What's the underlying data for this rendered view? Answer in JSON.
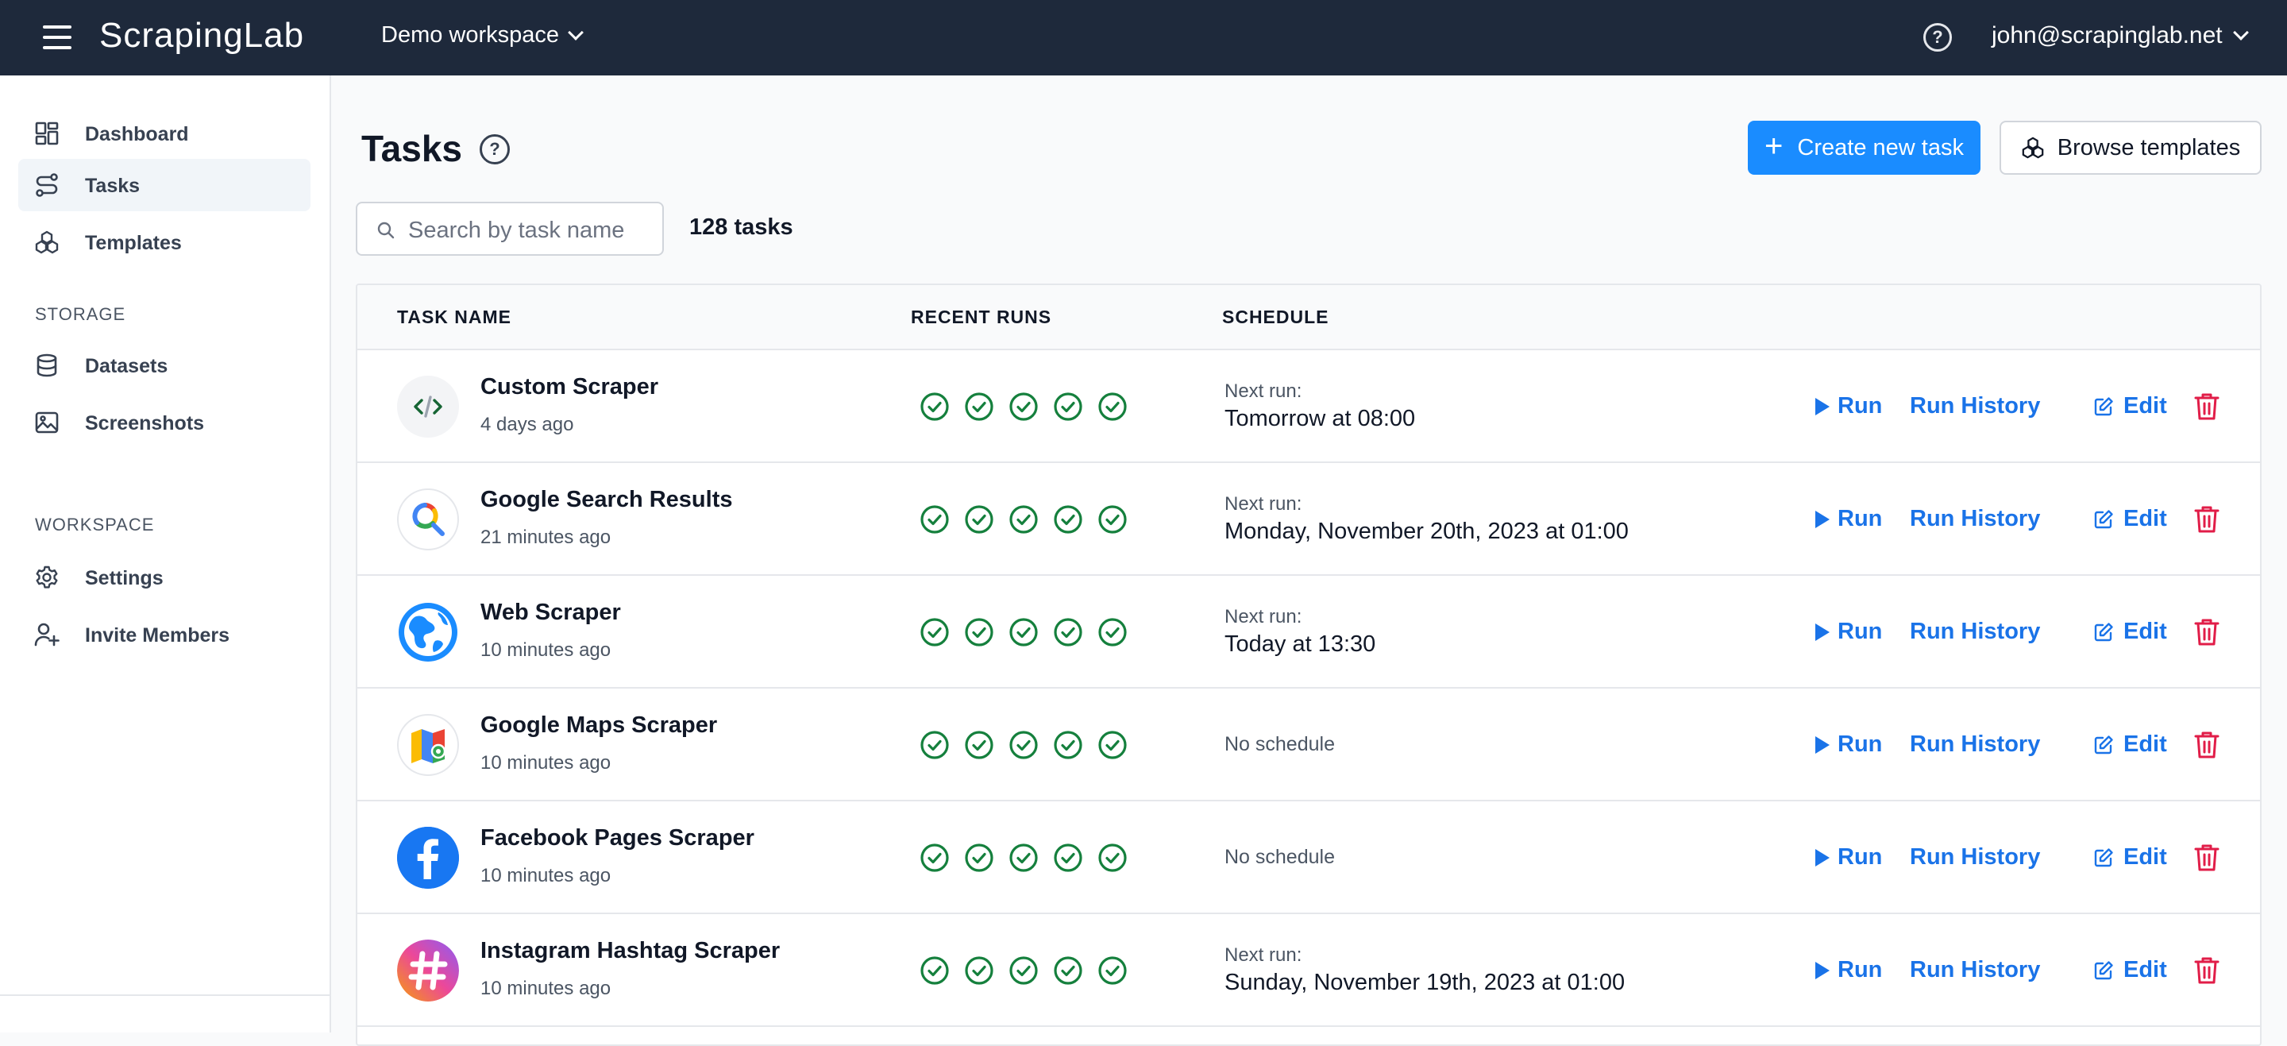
{
  "app": {
    "brand": "ScrapingLab",
    "workspace": "Demo workspace",
    "user_email": "john@scrapinglab.net",
    "help_glyph": "?"
  },
  "sidebar": {
    "items": [
      {
        "label": "Dashboard",
        "icon": "dashboard-icon"
      },
      {
        "label": "Tasks",
        "icon": "tasks-icon",
        "active": true
      },
      {
        "label": "Templates",
        "icon": "templates-icon"
      }
    ],
    "storage_label": "STORAGE",
    "storage_items": [
      {
        "label": "Datasets",
        "icon": "database-icon"
      },
      {
        "label": "Screenshots",
        "icon": "image-icon"
      }
    ],
    "workspace_label": "WORKSPACE",
    "workspace_items": [
      {
        "label": "Settings",
        "icon": "gear-icon"
      },
      {
        "label": "Invite Members",
        "icon": "user-plus-icon"
      }
    ]
  },
  "main": {
    "title": "Tasks",
    "create_label": "Create new task",
    "browse_label": "Browse templates",
    "search_placeholder": "Search by task name",
    "task_count": "128 tasks"
  },
  "table": {
    "columns": [
      "TASK NAME",
      "RECENT RUNS",
      "SCHEDULE"
    ],
    "run_label": "Run",
    "history_label": "Run History",
    "edit_label": "Edit",
    "next_run_label": "Next run:",
    "rows": [
      {
        "name": "Custom Scraper",
        "ago": "4 days ago",
        "icon": "code-icon",
        "schedule": "Tomorrow at 08:00",
        "recent_runs": [
          "success",
          "success",
          "success",
          "success",
          "success"
        ]
      },
      {
        "name": "Google Search Results",
        "ago": "21 minutes ago",
        "icon": "google-search-icon",
        "schedule": "Monday, November 20th, 2023 at 01:00",
        "recent_runs": [
          "success",
          "success",
          "success",
          "success",
          "success"
        ]
      },
      {
        "name": "Web Scraper",
        "ago": "10 minutes ago",
        "icon": "globe-icon",
        "schedule": "Today at 13:30",
        "recent_runs": [
          "success",
          "success",
          "success",
          "success",
          "success"
        ]
      },
      {
        "name": "Google Maps Scraper",
        "ago": "10 minutes ago",
        "icon": "google-maps-icon",
        "schedule": "No schedule",
        "recent_runs": [
          "success",
          "success",
          "success",
          "success",
          "success"
        ]
      },
      {
        "name": "Facebook Pages Scraper",
        "ago": "10 minutes ago",
        "icon": "facebook-icon",
        "schedule": "No schedule",
        "recent_runs": [
          "success",
          "success",
          "success",
          "success",
          "success"
        ]
      },
      {
        "name": "Instagram Hashtag Scraper",
        "ago": "10 minutes ago",
        "icon": "instagram-hashtag-icon",
        "schedule": "Sunday, November 19th, 2023 at 01:00",
        "recent_runs": [
          "success",
          "success",
          "success",
          "success",
          "success"
        ]
      }
    ]
  },
  "colors": {
    "topbar": "#1e293b",
    "primary": "#1a8cff",
    "link": "#1a73e8",
    "success": "#15803d",
    "danger": "#e11d48"
  }
}
